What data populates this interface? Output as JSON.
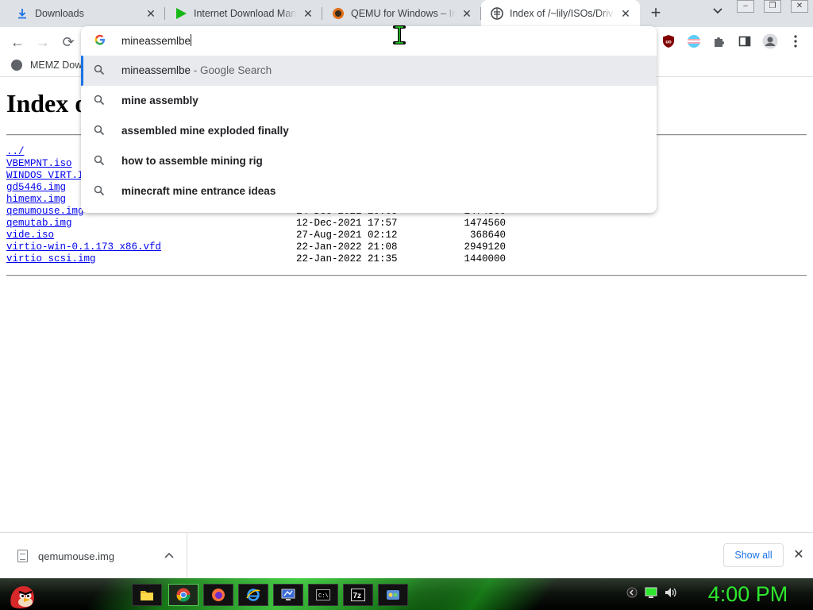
{
  "tabs": [
    {
      "title": "Downloads",
      "icon": "download-icon"
    },
    {
      "title": "Internet Download Manager",
      "icon": "idm-play-icon"
    },
    {
      "title": "QEMU for Windows – Installers",
      "icon": "qemu-icon"
    },
    {
      "title": "Index of /~lily/ISOs/Drivers/",
      "icon": "index-page-icon",
      "active": true
    }
  ],
  "omnibox": {
    "input_text": "mineassemlbe",
    "suggestions": [
      {
        "main": "mineassemlbe",
        "suffix": " - Google Search",
        "selected": true
      },
      {
        "main": "mine assembly"
      },
      {
        "main": "assembled mine exploded finally"
      },
      {
        "main": "how to assemble mining rig"
      },
      {
        "main": "minecraft mine entrance ideas"
      }
    ]
  },
  "bookmarks": [
    {
      "label": "MEMZ Dow"
    }
  ],
  "page": {
    "heading": "Index o",
    "entries": [
      {
        "name": "../",
        "date": "",
        "size": ""
      },
      {
        "name": "VBEMPNT.iso",
        "date": "",
        "size": ""
      },
      {
        "name": "WINDOS_VIRT.I",
        "date": "",
        "size": ""
      },
      {
        "name": "gd5446.img",
        "date": "",
        "size": ""
      },
      {
        "name": "himemx.img",
        "date": "",
        "size": ""
      },
      {
        "name": "qemumouse.img",
        "date": "14-Dec-2021 20:05",
        "size": "1474560"
      },
      {
        "name": "qemutab.img",
        "date": "12-Dec-2021 17:57",
        "size": "1474560"
      },
      {
        "name": "vide.iso",
        "date": "27-Aug-2021 02:12",
        "size": "368640"
      },
      {
        "name": "virtio-win-0.1.173_x86.vfd",
        "date": "22-Jan-2022 21:08",
        "size": "2949120"
      },
      {
        "name": "virtio_scsi.img",
        "date": "22-Jan-2022 21:35",
        "size": "1440000"
      }
    ]
  },
  "downloads": {
    "item_name": "qemumouse.img",
    "show_all_label": "Show all"
  },
  "taskbar": {
    "clock": "4:00 PM",
    "apps": [
      "file-explorer-icon",
      "chrome-icon",
      "firefox-icon",
      "ie-icon",
      "monitor-app-icon",
      "cmd-icon",
      "7zip-icon",
      "control-panel-icon"
    ]
  },
  "colors": {
    "tabstrip": "#dee1e6",
    "link": "#0000ee",
    "accent": "#1a73e8",
    "taskbar_green": "#2ee62e"
  }
}
